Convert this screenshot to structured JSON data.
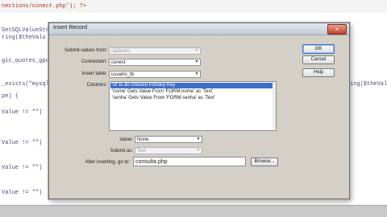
{
  "editor": {
    "lines": [
      {
        "text": "nections/conect.php'); ?>",
        "color": "#b12b1f"
      },
      {
        "text": "GetSQLValueStr",
        "color": "#4a4a7a"
      },
      {
        "text": "ring($theValu",
        "color": "#4a4a7a"
      },
      {
        "text": "gic_quotes_gpc",
        "color": "#4a4a7a"
      },
      {
        "text": "_exists(\"mysql",
        "color": "#4a4a7a"
      },
      {
        "text": "pe) {",
        "color": "#4a4a7a"
      },
      {
        "text": "Value != \"\")",
        "color": "#4a4a7a"
      },
      {
        "text": "Value != \"\")",
        "color": "#4a4a7a"
      },
      {
        "text": "Value != \"\")",
        "color": "#4a4a7a"
      },
      {
        "text": "Value != \"\")",
        "color": "#4a4a7a"
      }
    ],
    "right_fragment": "ing($theValue"
  },
  "dialog": {
    "title": "Insert Record",
    "close_glyph": "×",
    "labels": {
      "submit_from": "Submit values from:",
      "connection": "Connection:",
      "insert_table": "Insert table:",
      "columns": "Columns:",
      "value": "Value:",
      "submit_as": "Submit as:",
      "after_inserting": "After inserting, go to:"
    },
    "values": {
      "submit_from": "cadastro",
      "connection": "conect",
      "insert_table": "usuario_tb",
      "value": "None",
      "submit_as": "Text",
      "after_inserting": "consulta.php"
    },
    "columns": [
      {
        "text": "'id' Is an Unused Primary Key",
        "selected": true
      },
      {
        "text": "'nome' Gets Value From 'FORM.nome' as 'Text'",
        "selected": false
      },
      {
        "text": "'senha' Gets Value From 'FORM.senha' as 'Text'",
        "selected": false
      }
    ],
    "buttons": {
      "ok": "OK",
      "cancel": "Cancel",
      "help": "Help",
      "browse": "Browse..."
    },
    "dropdown_glyph": "▼",
    "accent_color": "#3d6fc7"
  }
}
